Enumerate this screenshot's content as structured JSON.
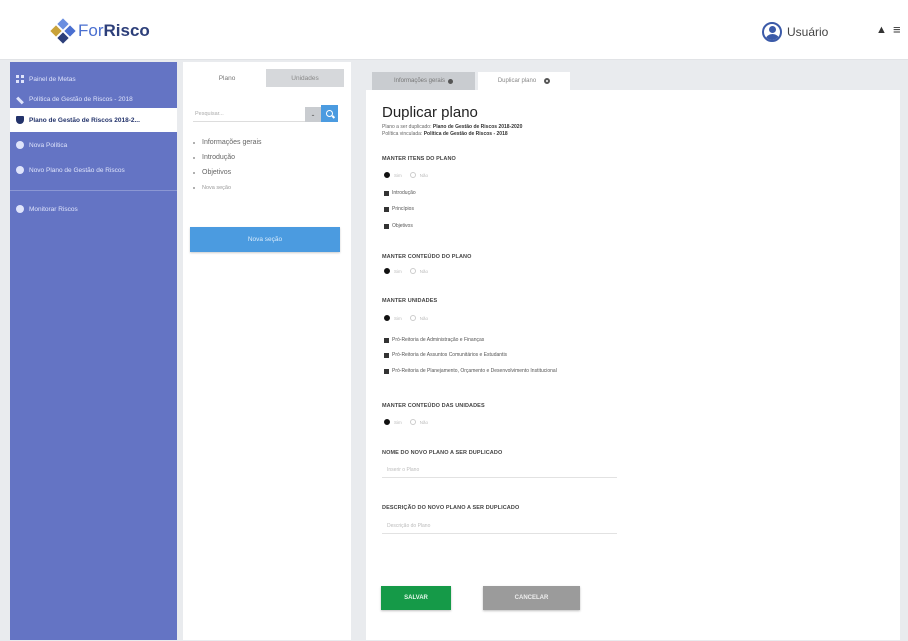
{
  "app": {
    "logo_prefix": "For",
    "logo_suffix": "Risco",
    "user_name": "Usuário",
    "colors": {
      "sidebar": "#6474c4",
      "primary": "#4b9be0",
      "save": "#159a48",
      "cancel": "#9b9b9b"
    }
  },
  "sidebar": {
    "items": [
      {
        "label": "Painel de Metas",
        "icon": "grid-icon"
      },
      {
        "label": "Política de Gestão de Riscos - 2018",
        "icon": "wrench-icon"
      },
      {
        "label": "Plano de Gestão de Riscos 2018-2...",
        "icon": "shield-icon",
        "active": true
      },
      {
        "label": "Nova Política",
        "icon": "plus-circle-icon"
      },
      {
        "label": "Novo Plano de Gestão de Riscos",
        "icon": "plus-circle-icon"
      },
      {
        "label": "Monitorar Riscos",
        "icon": "plus-circle-icon"
      }
    ]
  },
  "midpanel": {
    "tab_plano": "Plano",
    "tab_unidades": "Unidades",
    "search_placeholder": "Pesquisar...",
    "tree": [
      "Informações gerais",
      "Introdução",
      "Objetivos",
      "Nova seção"
    ],
    "new_section_button": "Nova seção"
  },
  "content_tabs": {
    "info": "Informações gerais",
    "duplicate": "Duplicar plano"
  },
  "form": {
    "title": "Duplicar plano",
    "sub_plan_label": "Plano a ser duplicado:",
    "sub_plan_value": "Plano de Gestão de Riscos 2018-2020",
    "sub_policy_label": "Política vinculada:",
    "sub_policy_value": "Política de Gestão de Riscos - 2018",
    "sec_itens": "MANTER ITENS DO PLANO",
    "yes": "Sim",
    "no": "Não",
    "itens": [
      "Introdução",
      "Princípios",
      "Objetivos"
    ],
    "sec_conteudo_plano": "MANTER CONTEÚDO DO PLANO",
    "sec_unidades": "MANTER UNIDADES",
    "unidades": [
      "Pró-Reitoria de Administração e Finanças",
      "Pró-Reitoria de Assuntos Comunitários e Estudantis",
      "Pró-Reitoria de Planejamento, Orçamento e Desenvolvimento Institucional"
    ],
    "sec_conteudo_unidades": "MANTER CONTEÚDO DAS UNIDADES",
    "sec_nome": "NOME DO NOVO PLANO A SER DUPLICADO",
    "nome_placeholder": "Inserir o Plano",
    "sec_descricao": "DESCRIÇÃO DO NOVO PLANO A SER DUPLICADO",
    "descricao_placeholder": "Descrição do Plano",
    "save": "SALVAR",
    "cancel": "CANCELAR"
  }
}
